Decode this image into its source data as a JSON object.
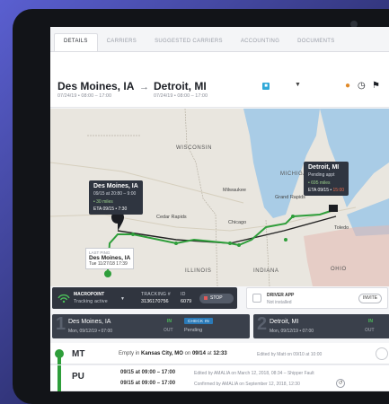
{
  "tabs": [
    "DETAILS",
    "CARRIERS",
    "SUGGESTED CARRIERS",
    "ACCOUNTING",
    "DOCUMENTS"
  ],
  "route": {
    "origin_city": "Des Moines, IA",
    "origin_time": "07/24/19 • 08:00 – 17:00",
    "dest_city": "Detroit, MI",
    "dest_time": "07/24/19 • 08:00 – 17:00",
    "arrow": "→"
  },
  "header_icons": [
    "flame-icon",
    "clock-icon",
    "flag-icon"
  ],
  "map": {
    "labels": {
      "wisconsin": "WISCONSIN",
      "michigan": "MICHIGAN",
      "illinois": "ILLINOIS",
      "indiana": "INDIANA",
      "ohio": "OHIO"
    },
    "cities": [
      "Milwaukee",
      "Grand Rapids",
      "Chicago",
      "Toledo",
      "Cedar Rapids"
    ],
    "origin_popup": {
      "title": "Des Moines, IA",
      "time": "09/15 at 20:80 – 9:00",
      "miles": "• 30 miles",
      "eta": "ETA 09/15 • 7:30"
    },
    "dest_popup": {
      "title": "Detroit, MI",
      "status": "Pending appt",
      "miles": "• 695 miles",
      "eta_prefix": "ETA 09/15 •",
      "eta_late": "15:00"
    },
    "last_ping": {
      "title": "LAST PING",
      "city": "Des Moines, IA",
      "time": "Tue 11/27/18 17:39"
    }
  },
  "tracking": {
    "provider": "MACROPOINT",
    "status": "Tracking active",
    "tracking_label": "TRACKING #",
    "tracking_value": "3136170756",
    "id_label": "ID",
    "id_value": "6079",
    "stop_label": "STOP",
    "driver_app_label": "DRIVER APP",
    "driver_app_status": "Not installed",
    "invite_label": "INVITE"
  },
  "stops": [
    {
      "num": "1",
      "city": "Des Moines, IA",
      "time": "Mon, 09/12/19 • 07:00",
      "in": "IN",
      "out": "OUT",
      "checkin": "CHECK IN",
      "status": "Pending"
    },
    {
      "num": "2",
      "city": "Detroit, MI",
      "time": "Mon, 09/12/19 • 07:00",
      "in": "IN",
      "out": "OUT"
    }
  ],
  "events": {
    "mt": {
      "code": "MT",
      "pre": "Empty in",
      "city": "Kansas City, MO",
      "mid": "on",
      "date": "09/14",
      "at": "at",
      "time": "12:33",
      "edited": "Edited by Matt on 09/10 at 10:00"
    },
    "pu": {
      "code": "PU",
      "line1_times": "09/15 at 09:00 – 17:00",
      "line1_note": "Edited by AMALIA on March 12, 2018, 08:34 – Shipper Fault",
      "line2_times": "09/15 at 09:00 – 17:00",
      "line2_note": "Confirmed by AMALIA on September 12, 2018, 12:30"
    }
  },
  "colors": {
    "route_green": "#2e9e3a",
    "panel_dark": "#30353f",
    "accent_blue": "#2a7ab8"
  }
}
